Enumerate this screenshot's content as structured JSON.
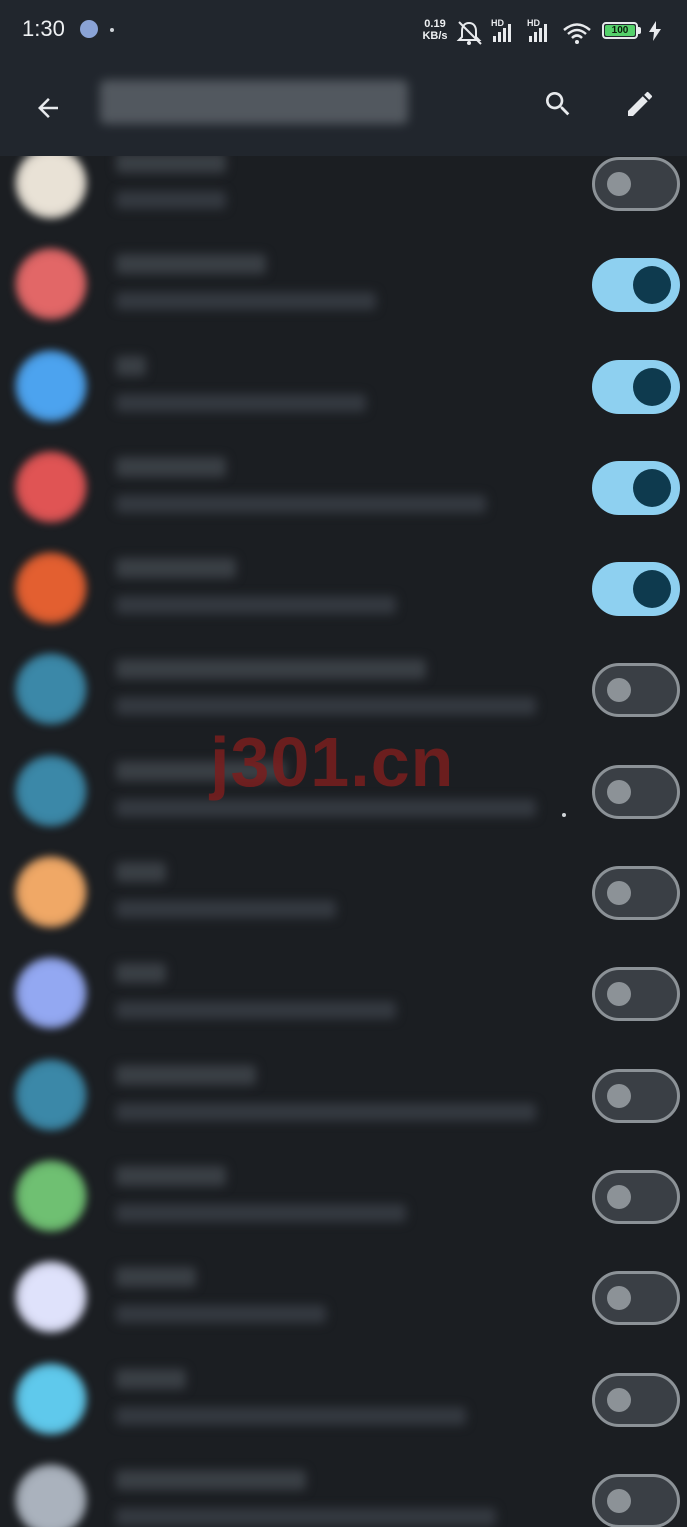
{
  "status_bar": {
    "time": "1:30",
    "network_speed_value": "0.19",
    "network_speed_unit": "KB/s",
    "signal_1_label": "HD",
    "signal_2_label": "HD",
    "battery_level": "100",
    "icons": [
      "face-icon",
      "mute-bell-icon",
      "signal-icon",
      "wifi-icon",
      "battery-icon",
      "charging-icon"
    ]
  },
  "app_bar": {
    "title": "",
    "icons": [
      "back-arrow-icon",
      "search-icon",
      "edit-pencil-icon"
    ]
  },
  "apps": [
    {
      "icon_color": "#e9e2d6",
      "enabled": false
    },
    {
      "icon_color": "#e26767",
      "enabled": true
    },
    {
      "icon_color": "#4ca3ef",
      "enabled": true
    },
    {
      "icon_color": "#e05454",
      "enabled": true
    },
    {
      "icon_color": "#e35f30",
      "enabled": true
    },
    {
      "icon_color": "#3b88a8",
      "enabled": false
    },
    {
      "icon_color": "#3b88a8",
      "enabled": false
    },
    {
      "icon_color": "#f0a866",
      "enabled": false
    },
    {
      "icon_color": "#93a8f2",
      "enabled": false
    },
    {
      "icon_color": "#3b88a8",
      "enabled": false
    },
    {
      "icon_color": "#6fc072",
      "enabled": false
    },
    {
      "icon_color": "#dfe2fb",
      "enabled": false
    },
    {
      "icon_color": "#5fc9ec",
      "enabled": false
    },
    {
      "icon_color": "#aab2bd",
      "enabled": false
    }
  ],
  "watermark": "j301.cn",
  "colors": {
    "background": "#1b1e22",
    "bar": "#21262d",
    "toggle_on": "#8ed0f0",
    "toggle_knob_on": "#0e3a4e",
    "toggle_off_border": "#8c9297"
  }
}
